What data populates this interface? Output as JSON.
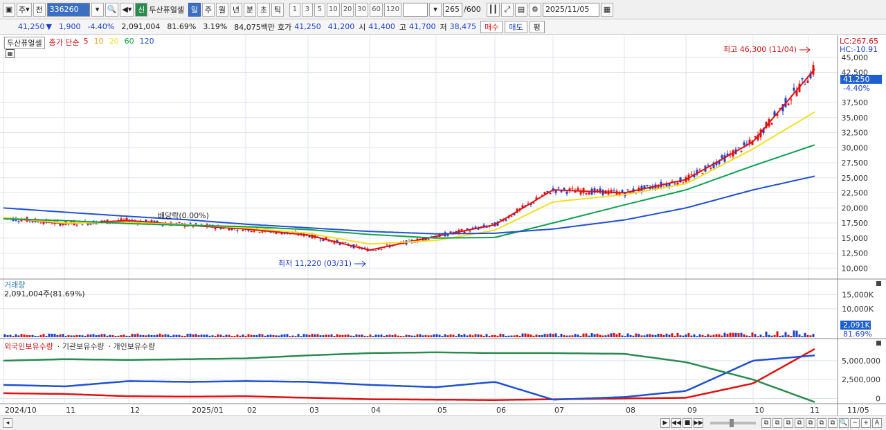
{
  "toolbar": {
    "market_label": "주",
    "prev_label": "전",
    "code_value": "336260",
    "stock_name": "두산퓨얼셀",
    "stock_badge": "신",
    "periods": [
      "일",
      "주",
      "월",
      "년",
      "분",
      "초",
      "틱"
    ],
    "period_selected": "일",
    "intervals": [
      "1",
      "3",
      "5",
      "10",
      "20",
      "30",
      "60",
      "120"
    ],
    "count_value": "265",
    "count_total": "/600",
    "date_value": "2025/11/05"
  },
  "quote": {
    "price": "41,250",
    "direction": "▼",
    "change": "1,900",
    "change_pct": "-4.40%",
    "volume": "2,091,004",
    "turnover_ratio": "81.69%",
    "rate": "3.19%",
    "amount": "84,075백만",
    "ask_label": "호가",
    "ask1": "41,250",
    "ask2": "41,200",
    "open_label": "시",
    "open": "41,400",
    "high_label": "고",
    "high": "41,700",
    "low_label": "저",
    "low": "38,475",
    "buy_label": "매수",
    "sell_label": "매도",
    "eval_label": "평"
  },
  "price_panel": {
    "title": "두산퓨얼셀",
    "ma_label": "종가 단순",
    "ma_periods": [
      {
        "label": "5",
        "color": "#e01010"
      },
      {
        "label": "10",
        "color": "#f0a020"
      },
      {
        "label": "20",
        "color": "#f0e020"
      },
      {
        "label": "60",
        "color": "#10a050"
      },
      {
        "label": "120",
        "color": "#2050d0"
      }
    ],
    "lc_text": "LC:267.65",
    "hc_text": "HC:-10.91",
    "high_annotation": "최고 46,300 (11/04)",
    "low_annotation": "최저 11,220 (03/31)",
    "dividend_annotation": "배당락(0.00%)",
    "current_price_tag": "41,250",
    "current_pct_tag": "-4.40%",
    "y_ticks": [
      "45,000",
      "42,500",
      "37,500",
      "35,000",
      "32,500",
      "30,000",
      "27,500",
      "25,000",
      "22,500",
      "20,000",
      "17,500",
      "15,000",
      "12,500",
      "10,000"
    ]
  },
  "volume_panel": {
    "title": "거래량",
    "value_text": "2,091,004주(81.69%)",
    "y_ticks": [
      "15,000K",
      "10,000K"
    ],
    "current_tag": "2,091K",
    "current_pct": "81.69%"
  },
  "ownership_panel": {
    "series": [
      {
        "label": "외국인보유수량",
        "color": "#e01010"
      },
      {
        "label": "기관보유수량",
        "color": "#2050d0"
      },
      {
        "label": "개인보유수량",
        "color": "#2a8a50"
      }
    ],
    "y_ticks": [
      "5,000,000",
      "2,500,000",
      "0"
    ]
  },
  "x_axis": [
    "2024/10",
    "11",
    "12",
    "2025/01",
    "02",
    "03",
    "04",
    "05",
    "06",
    "07",
    "08",
    "09",
    "10",
    "11",
    "11/05"
  ],
  "chart_data": {
    "type": "line",
    "title": "두산퓨얼셀",
    "x": [
      "2024/10",
      "11",
      "12",
      "2025/01",
      "02",
      "03",
      "04",
      "05",
      "06",
      "07",
      "08",
      "09",
      "10",
      "11"
    ],
    "ylim": [
      10000,
      46300
    ],
    "series": [
      {
        "name": "5",
        "values": [
          18400,
          17400,
          17900,
          17100,
          16500,
          15500,
          13000,
          15300,
          17200,
          23000,
          22500,
          24700,
          31000,
          43200
        ]
      },
      {
        "name": "20",
        "values": [
          18400,
          17500,
          17600,
          17200,
          16700,
          15800,
          14000,
          14600,
          16300,
          21000,
          22200,
          24000,
          29800,
          36000
        ]
      },
      {
        "name": "60",
        "values": [
          18200,
          17900,
          17400,
          17100,
          16900,
          16400,
          15600,
          15000,
          15100,
          17500,
          20500,
          23000,
          27000,
          30500
        ]
      },
      {
        "name": "120",
        "values": [
          20000,
          19300,
          18600,
          18000,
          17300,
          16700,
          16100,
          15700,
          15800,
          16500,
          18000,
          20000,
          23000,
          25300
        ]
      }
    ],
    "high_point": {
      "label": "11/04",
      "value": 46300
    },
    "low_point": {
      "label": "03/31",
      "value": 11220
    },
    "ownership": {
      "series": [
        {
          "name": "외국인보유수량",
          "values": [
            700000,
            600000,
            300000,
            250000,
            300000,
            100000,
            -100000,
            -150000,
            -200000,
            -100000,
            0,
            100000,
            2000000,
            6600000
          ]
        },
        {
          "name": "기관보유수량",
          "values": [
            1800000,
            1600000,
            2300000,
            2200000,
            2300000,
            2200000,
            1800000,
            1500000,
            2200000,
            -150000,
            200000,
            1000000,
            5000000,
            5700000
          ]
        },
        {
          "name": "개인보유수량",
          "values": [
            5000000,
            5200000,
            5100000,
            5200000,
            5300000,
            5700000,
            6000000,
            6100000,
            6000000,
            6000000,
            5900000,
            4800000,
            2500000,
            -500000
          ]
        }
      ]
    }
  }
}
